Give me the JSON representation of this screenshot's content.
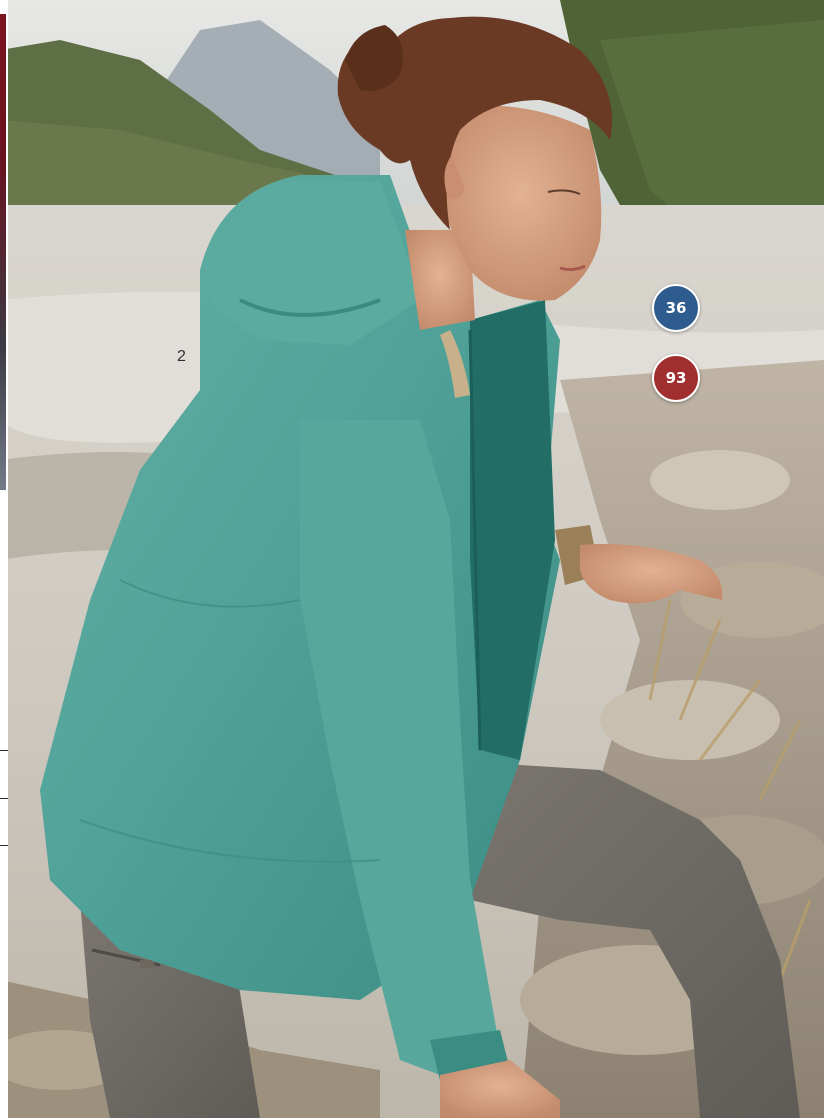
{
  "page": {
    "page_number": "2"
  },
  "hotspots": [
    {
      "label": "36",
      "color": "#2f5c8f"
    },
    {
      "label": "93",
      "color": "#a02e2e"
    }
  ],
  "photo": {
    "subject": "woman-in-teal-hooded-jacket",
    "palette": {
      "jacket": "#4fa197",
      "jacket_shadow": "#2f7d75",
      "jacket_inner": "#1f6a63",
      "hair": "#6b3a24",
      "skin": "#d6a184",
      "pants": "#6f6b66",
      "river": "#d8d4cc",
      "mountain": "#8e9aa5",
      "trees": "#4f6a3a"
    }
  }
}
